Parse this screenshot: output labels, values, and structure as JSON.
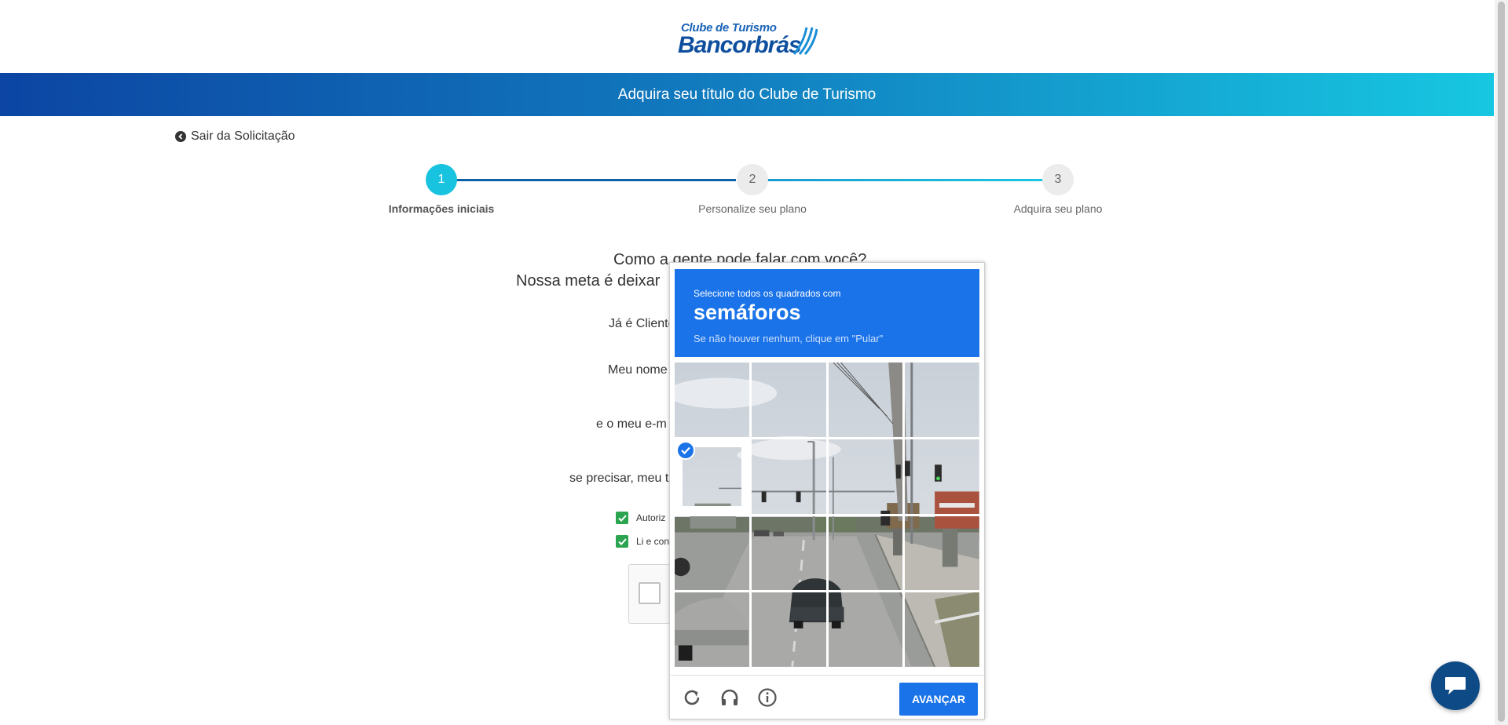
{
  "header": {
    "logo_small": "Clube de Turismo",
    "logo_big": "Bancorbrás",
    "banner_title": "Adquira seu título do Clube de Turismo"
  },
  "exit_link": {
    "label": "Sair da Solicitação"
  },
  "stepper": {
    "steps": [
      {
        "number": "1",
        "label": "Informações iniciais",
        "active": true
      },
      {
        "number": "2",
        "label": "Personalize seu plano",
        "active": false
      },
      {
        "number": "3",
        "label": "Adquira seu plano",
        "active": false
      }
    ]
  },
  "form": {
    "question_1": "Como a gente pode falar com você?",
    "question_2_partial": "Nossa meta é deixar",
    "already_client_partial": "Já é Cliente",
    "name_partial": "Meu nome",
    "email_partial": "e o meu e-m",
    "phone_partial": "se precisar, meu te",
    "consent_1_partial": "Autoriz",
    "consent_2_partial": "Li e con"
  },
  "captcha": {
    "instruction": "Selecione todos os quadrados com",
    "target": "semáforos",
    "hint": "Se não houver nenhum, clique em \"Pular\"",
    "verify_label": "AVANÇAR",
    "selected_tiles": [
      4
    ],
    "icons": [
      "reload-icon",
      "headphones-icon",
      "info-icon"
    ]
  },
  "colors": {
    "brand_blue": "#0c45a3",
    "accent_cyan": "#17c3df",
    "captcha_blue": "#1a73e8",
    "check_green": "#2aa44f",
    "chat_navy": "#0e4a86"
  }
}
